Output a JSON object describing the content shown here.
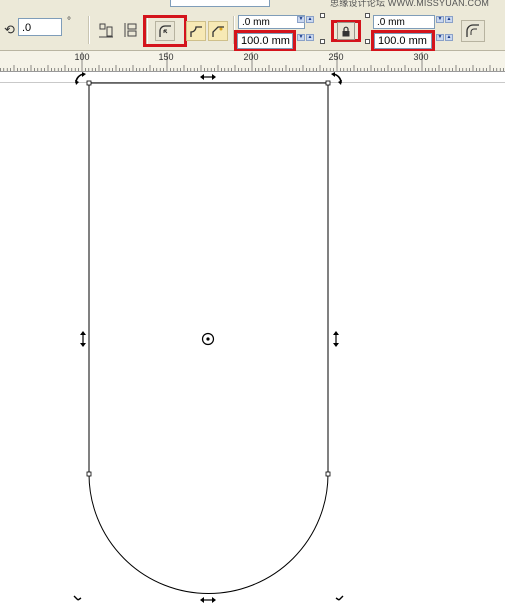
{
  "watermark": "思缘设计论坛 WWW.MISSYUAN.COM",
  "property_bar": {
    "rotation_value": ".0",
    "degree_symbol": "°",
    "corner_fields": {
      "top_left": ".0 mm",
      "bottom_left": "100.0 mm",
      "top_right": ".0 mm",
      "bottom_right": "100.0 mm"
    },
    "highlight_color": "#d4141c"
  },
  "ruler": {
    "labels": [
      "100",
      "150",
      "200",
      "250",
      "300"
    ]
  },
  "icons": [
    "rotate-icon",
    "align-icon",
    "wrap-icon",
    "round-corner-icon",
    "scalloped-corner-icon",
    "chamfer-corner-icon",
    "lock-icon",
    "scale-corners-icon",
    "center-mark-icon"
  ]
}
